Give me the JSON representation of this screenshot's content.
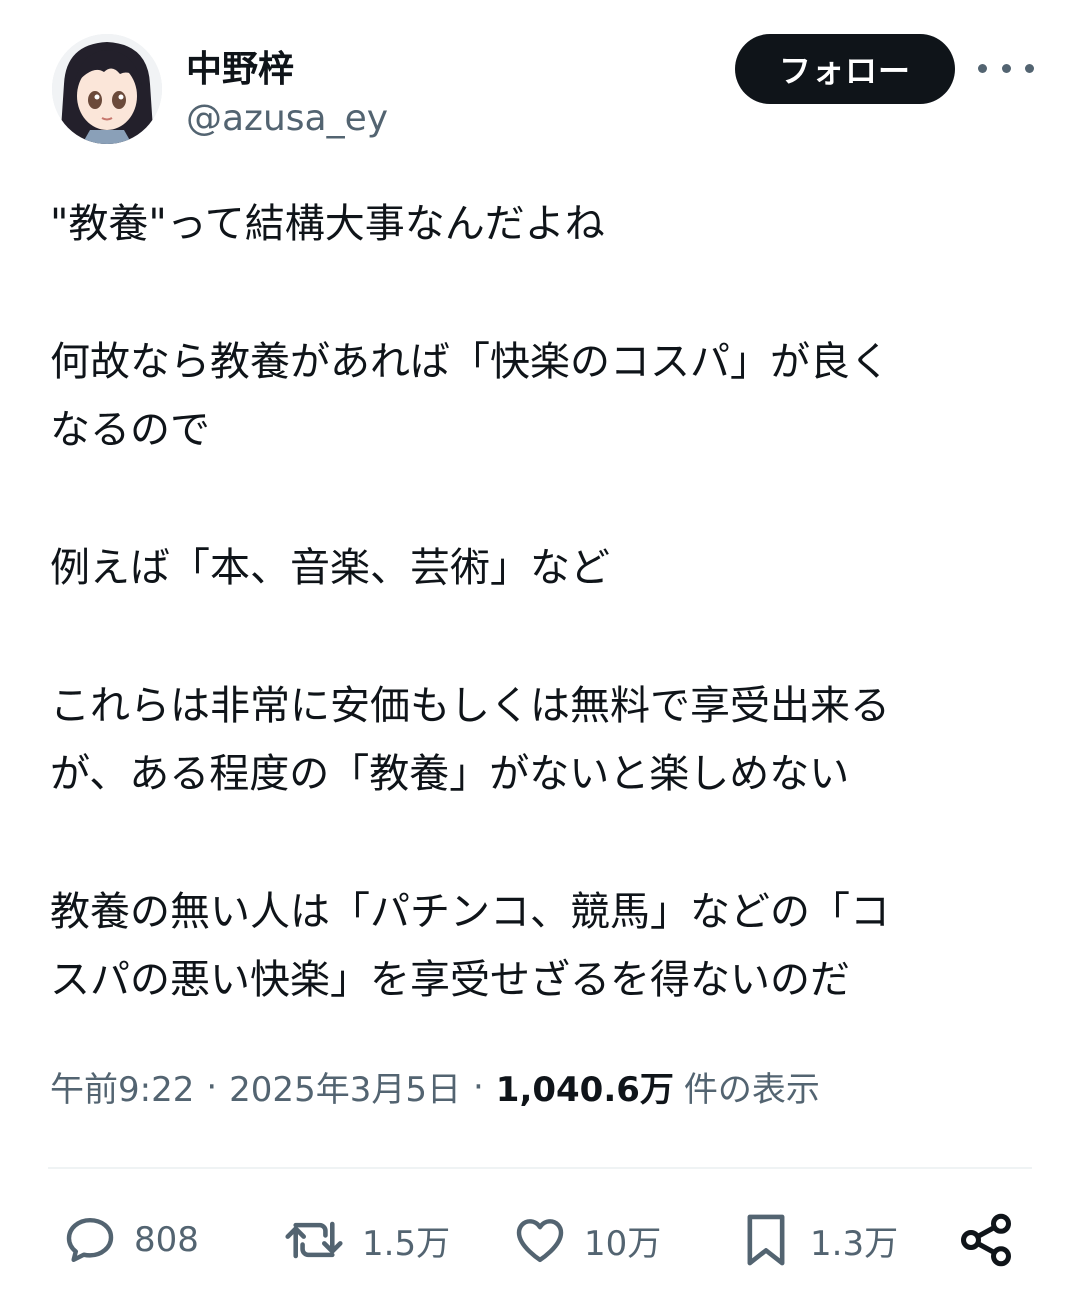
{
  "author": {
    "display_name": "中野梓",
    "handle": "@azusa_ey"
  },
  "header": {
    "follow_label": "フォロー",
    "more_icon": "more-horizontal-icon"
  },
  "tweet": {
    "lines": [
      "\"教養\"って結構大事なんだよね",
      "何故なら教養があれば「快楽のコスパ」が良く",
      "なるので",
      "例えば「本、音楽、芸術」など",
      "これらは非常に安価もしくは無料で享受出来る",
      "が、ある程度の「教養」がないと楽しめない",
      "教養の無い人は「パチンコ、競馬」などの「コ",
      "スパの悪い快楽」を享受せざるを得ないのだ"
    ]
  },
  "meta": {
    "time": "午前9:22",
    "separator": "·",
    "date": "2025年3月5日",
    "views_count": "1,040.6万",
    "views_label": "件の表示"
  },
  "actions": {
    "replies": "808",
    "retweets": "1.5万",
    "likes": "10万",
    "bookmarks": "1.3万"
  },
  "colors": {
    "text": "#0f1419",
    "secondary": "#536471",
    "follow_button_bg": "#0f1419",
    "divider": "#eff3f4"
  }
}
